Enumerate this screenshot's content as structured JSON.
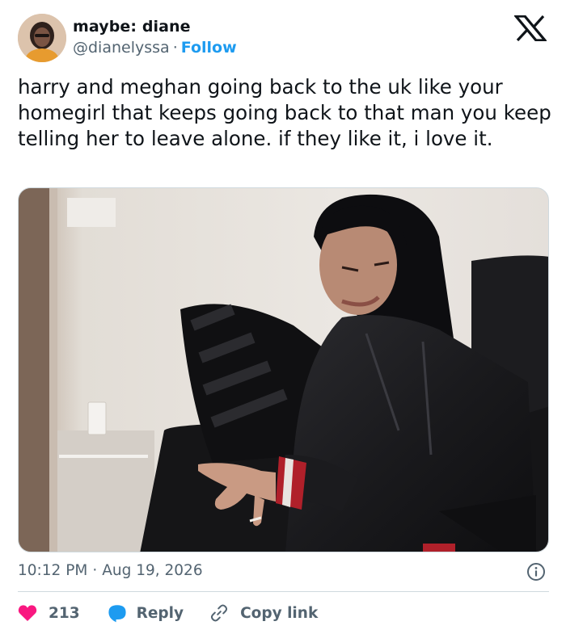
{
  "author": {
    "display_name": "maybe: diane",
    "handle": "@dianelyssa",
    "separator": "·",
    "follow_label": "Follow"
  },
  "tweet": {
    "text": "harry and meghan going back to the uk like your homegirl that keeps going back to that man you keep telling her to leave alone. if they like it, i love it.",
    "time": "10:12 PM",
    "date_separator": "·",
    "date": "Aug 19, 2026"
  },
  "actions": {
    "like_count": "213",
    "reply_label": "Reply",
    "copy_link_label": "Copy link"
  },
  "icons": {
    "logo": "x-logo-icon",
    "like": "heart-icon",
    "reply": "speech-bubble-icon",
    "copy": "link-icon",
    "info": "info-icon"
  },
  "colors": {
    "text": "#0f1419",
    "secondary": "#536471",
    "link": "#1d9bf0",
    "like": "#f91880",
    "border": "#cfd9de"
  }
}
